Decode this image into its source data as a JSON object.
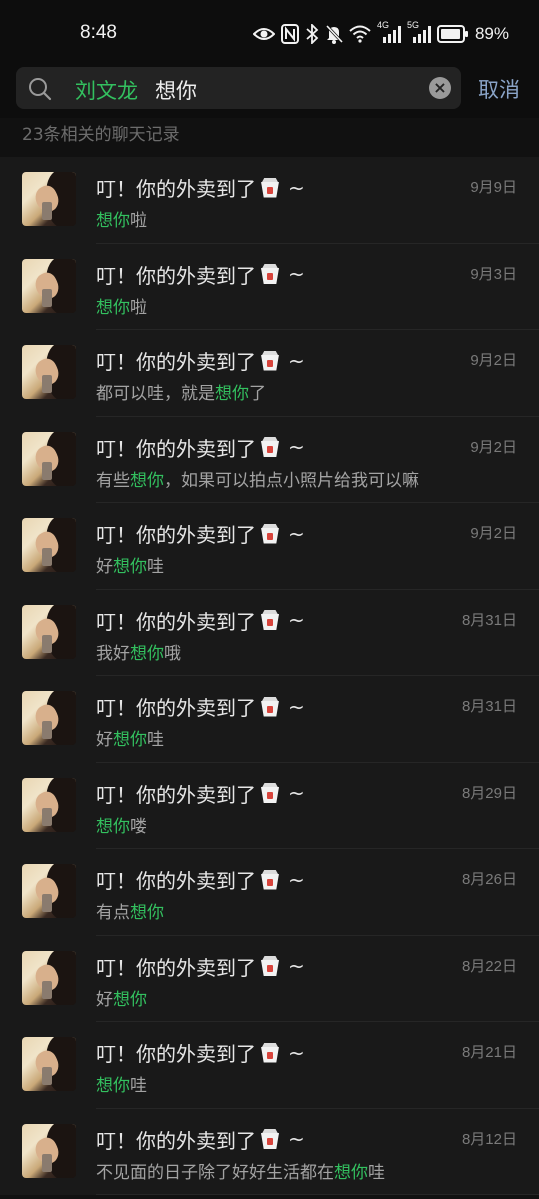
{
  "status_bar": {
    "time": "8:48",
    "network_4g": "4G",
    "network_5g": "5G",
    "battery": "89%"
  },
  "search": {
    "chip": "刘文龙",
    "query": "想你",
    "cancel_label": "取消"
  },
  "result_count": "23条相关的聊天记录",
  "results": [
    {
      "name": "叮！你的外卖到了",
      "suffix": "~",
      "date": "9月9日",
      "before": "",
      "match": "想你",
      "after": "啦"
    },
    {
      "name": "叮！你的外卖到了",
      "suffix": "~",
      "date": "9月3日",
      "before": "",
      "match": "想你",
      "after": "啦"
    },
    {
      "name": "叮！你的外卖到了",
      "suffix": "~",
      "date": "9月2日",
      "before": "都可以哇，就是",
      "match": "想你",
      "after": "了"
    },
    {
      "name": "叮！你的外卖到了",
      "suffix": "~",
      "date": "9月2日",
      "before": "有些",
      "match": "想你",
      "after": "，如果可以拍点小照片给我可以嘛"
    },
    {
      "name": "叮！你的外卖到了",
      "suffix": "~",
      "date": "9月2日",
      "before": "好",
      "match": "想你",
      "after": "哇"
    },
    {
      "name": "叮！你的外卖到了",
      "suffix": "~",
      "date": "8月31日",
      "before": "我好",
      "match": "想你",
      "after": "哦"
    },
    {
      "name": "叮！你的外卖到了",
      "suffix": "~",
      "date": "8月31日",
      "before": "好",
      "match": "想你",
      "after": "哇"
    },
    {
      "name": "叮！你的外卖到了",
      "suffix": "~",
      "date": "8月29日",
      "before": "",
      "match": "想你",
      "after": "喽"
    },
    {
      "name": "叮！你的外卖到了",
      "suffix": "~",
      "date": "8月26日",
      "before": "有点",
      "match": "想你",
      "after": ""
    },
    {
      "name": "叮！你的外卖到了",
      "suffix": "~",
      "date": "8月22日",
      "before": "好",
      "match": "想你",
      "after": ""
    },
    {
      "name": "叮！你的外卖到了",
      "suffix": "~",
      "date": "8月21日",
      "before": "",
      "match": "想你",
      "after": "哇"
    },
    {
      "name": "叮！你的外卖到了",
      "suffix": "~",
      "date": "8月12日",
      "before": "不见面的日子除了好好生活都在",
      "match": "想你",
      "after": "哇"
    }
  ],
  "colors": {
    "highlight": "#33c05f",
    "cancel": "#8aa4c8",
    "background": "#111111",
    "row": "#191919"
  }
}
